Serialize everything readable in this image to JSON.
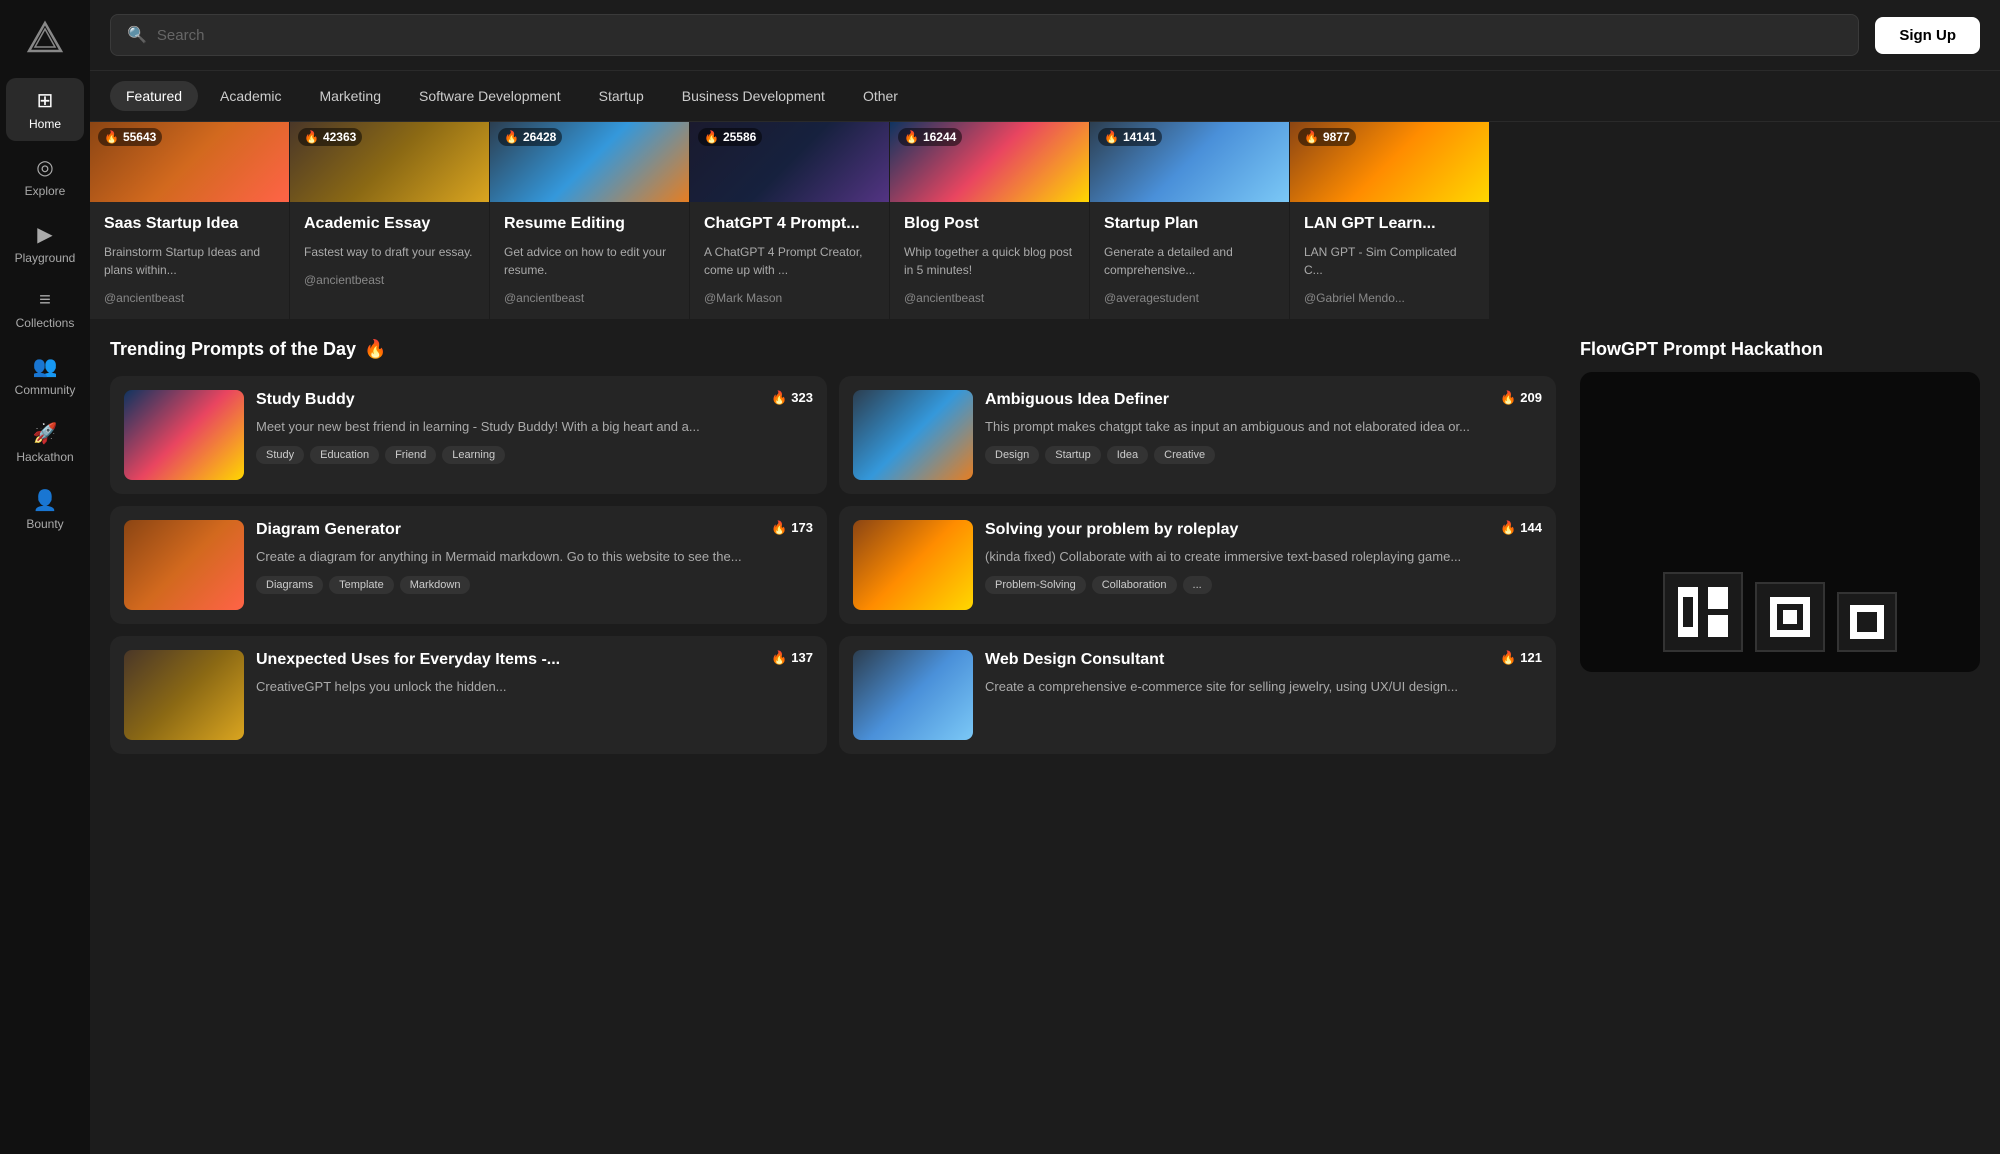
{
  "app": {
    "name": "FlowGPT",
    "logo_text": "▽"
  },
  "sidebar": {
    "items": [
      {
        "id": "home",
        "label": "Home",
        "icon": "⊞",
        "active": true
      },
      {
        "id": "explore",
        "label": "Explore",
        "icon": "◎",
        "active": false
      },
      {
        "id": "playground",
        "label": "Playground",
        "icon": "▶",
        "active": false
      },
      {
        "id": "collections",
        "label": "Collections",
        "icon": "≡",
        "active": false
      },
      {
        "id": "community",
        "label": "Community",
        "icon": "👥",
        "active": false
      },
      {
        "id": "hackathon",
        "label": "Hackathon",
        "icon": "🚀",
        "active": false
      },
      {
        "id": "bounty",
        "label": "Bounty",
        "icon": "👤",
        "active": false
      }
    ]
  },
  "header": {
    "search_placeholder": "Search",
    "sign_up_label": "Sign Up"
  },
  "tabs": [
    {
      "id": "featured",
      "label": "Featured",
      "active": true
    },
    {
      "id": "academic",
      "label": "Academic",
      "active": false
    },
    {
      "id": "marketing",
      "label": "Marketing",
      "active": false
    },
    {
      "id": "software-dev",
      "label": "Software Development",
      "active": false
    },
    {
      "id": "startup",
      "label": "Startup",
      "active": false
    },
    {
      "id": "business-dev",
      "label": "Business Development",
      "active": false
    },
    {
      "id": "other",
      "label": "Other",
      "active": false
    }
  ],
  "featured_cards": [
    {
      "title": "Saas Startup Idea",
      "description": "Brainstorm Startup Ideas and plans within...",
      "author": "@ancientbeast",
      "likes": "55643",
      "gradient": "img-gradient-1"
    },
    {
      "title": "Academic Essay",
      "description": "Fastest way to draft your essay.",
      "author": "@ancientbeast",
      "likes": "42363",
      "gradient": "img-gradient-2"
    },
    {
      "title": "Resume Editing",
      "description": "Get advice on how to edit your resume.",
      "author": "@ancientbeast",
      "likes": "26428",
      "gradient": "img-gradient-3"
    },
    {
      "title": "ChatGPT 4 Prompt...",
      "description": "A ChatGPT 4 Prompt Creator, come up with ...",
      "author": "@Mark Mason",
      "likes": "25586",
      "gradient": "img-gradient-4"
    },
    {
      "title": "Blog Post",
      "description": "Whip together a quick blog post in 5 minutes!",
      "author": "@ancientbeast",
      "likes": "16244",
      "gradient": "img-gradient-5"
    },
    {
      "title": "Startup Plan",
      "description": "Generate a detailed and comprehensive...",
      "author": "@averagestudent",
      "likes": "14141",
      "gradient": "img-gradient-6"
    },
    {
      "title": "LAN GPT Learn...",
      "description": "LAN GPT - Sim Complicated C...",
      "author": "@Gabriel Mendo...",
      "likes": "9877",
      "gradient": "img-gradient-7"
    }
  ],
  "trending": {
    "title": "Trending Prompts of the Day",
    "emoji": "🔥",
    "cards": [
      {
        "title": "Study Buddy",
        "description": "Meet your new best friend in learning - Study Buddy! With a big heart and a...",
        "likes": "323",
        "tags": [
          "Study",
          "Education",
          "Friend",
          "Learning"
        ],
        "gradient": "img-gradient-5"
      },
      {
        "title": "Ambiguous Idea Definer",
        "description": "This prompt makes chatgpt take as input an ambiguous and not elaborated idea or...",
        "likes": "209",
        "tags": [
          "Design",
          "Startup",
          "Idea",
          "Creative"
        ],
        "gradient": "img-gradient-3"
      },
      {
        "title": "Diagram Generator",
        "description": "Create a diagram for anything in Mermaid markdown. Go to this website to see the...",
        "likes": "173",
        "tags": [
          "Diagrams",
          "Template",
          "Markdown"
        ],
        "gradient": "img-gradient-1"
      },
      {
        "title": "Solving your problem by roleplay",
        "description": "(kinda fixed) Collaborate with ai to create immersive text-based roleplaying game...",
        "likes": "144",
        "tags": [
          "Problem-Solving",
          "Collaboration",
          "..."
        ],
        "gradient": "img-gradient-7"
      },
      {
        "title": "Unexpected Uses for Everyday Items -...",
        "description": "CreativeGPT helps you unlock the hidden...",
        "likes": "137",
        "tags": [],
        "gradient": "img-gradient-2"
      },
      {
        "title": "Web Design Consultant",
        "description": "Create a comprehensive e-commerce site for selling jewelry, using UX/UI design...",
        "likes": "121",
        "tags": [],
        "gradient": "img-gradient-6"
      }
    ]
  },
  "hackathon": {
    "title": "FlowGPT Prompt Hackathon"
  }
}
